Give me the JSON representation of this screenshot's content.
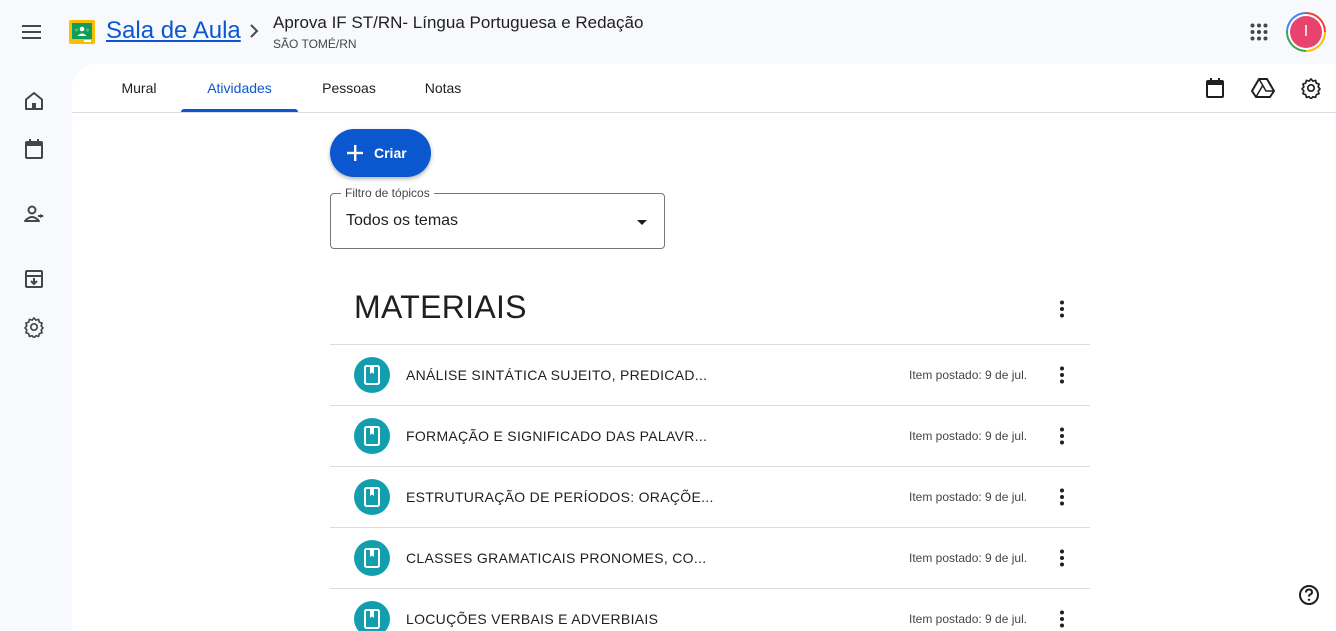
{
  "header": {
    "app_name": "Sala de Aula",
    "course_title": "Aprova IF ST/RN- Língua Portuguesa e Redação",
    "course_subtitle": "SÃO TOMÉ/RN",
    "avatar_letter": "I"
  },
  "tabs": [
    {
      "label": "Mural",
      "active": false
    },
    {
      "label": "Atividades",
      "active": true
    },
    {
      "label": "Pessoas",
      "active": false
    },
    {
      "label": "Notas",
      "active": false
    }
  ],
  "create_button": {
    "label": "Criar"
  },
  "topic_filter": {
    "label": "Filtro de tópicos",
    "value": "Todos os temas"
  },
  "section": {
    "title": "MATERIAIS"
  },
  "items": [
    {
      "title": "ANÁLISE SINTÁTICA SUJEITO, PREDICAD...",
      "date": "Item postado: 9 de jul."
    },
    {
      "title": "FORMAÇÃO E SIGNIFICADO DAS PALAVR...",
      "date": "Item postado: 9 de jul."
    },
    {
      "title": "ESTRUTURAÇÃO DE PERÍODOS: ORAÇÕE...",
      "date": "Item postado: 9 de jul."
    },
    {
      "title": "CLASSES GRAMATICAIS PRONOMES, CO...",
      "date": "Item postado: 9 de jul."
    },
    {
      "title": "LOCUÇÕES VERBAIS E ADVERBIAIS",
      "date": "Item postado: 9 de jul."
    }
  ],
  "colors": {
    "accent": "#0b57d0",
    "material_icon": "#129eaf",
    "avatar": "#e8426e"
  },
  "icons": {
    "main_menu": "menu-icon",
    "logo": "classroom-logo",
    "breadcrumb_separator": "chevron-right-icon",
    "google_apps": "apps-grid-icon",
    "rail": [
      "home-icon",
      "calendar-icon",
      "people-icon",
      "archive-icon",
      "settings-icon"
    ],
    "tab_bar": [
      "calendar-icon",
      "drive-icon",
      "settings-icon"
    ],
    "create": "plus-icon",
    "filter": "dropdown-arrow-icon",
    "item": "book-icon",
    "more": "more-vert-icon",
    "help": "help-icon"
  }
}
